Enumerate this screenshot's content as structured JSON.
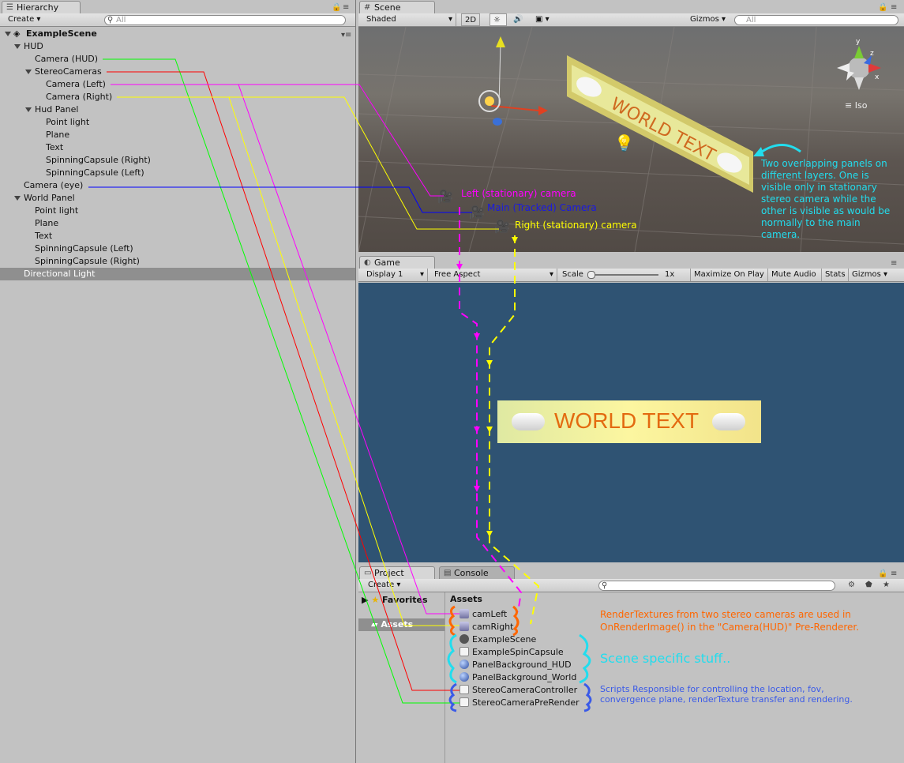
{
  "hierarchy": {
    "tab": "Hierarchy",
    "create": "Create",
    "search_placeholder": "All",
    "scene_name": "ExampleScene",
    "rows": {
      "hud": "HUD",
      "camera_hud": "Camera (HUD)",
      "stereo_cameras": "StereoCameras",
      "camera_left": "Camera (Left)",
      "camera_right": "Camera (Right)",
      "hud_panel": "Hud Panel",
      "point_light_1": "Point light",
      "plane_1": "Plane",
      "text_1": "Text",
      "capsule_right_1": "SpinningCapsule (Right)",
      "capsule_left_1": "SpinningCapsule (Left)",
      "camera_eye": "Camera (eye)",
      "world_panel": "World Panel",
      "point_light_2": "Point light",
      "plane_2": "Plane",
      "text_2": "Text",
      "capsule_left_2": "SpinningCapsule (Left)",
      "capsule_right_2": "SpinningCapsule (Right)",
      "directional_light": "Directional Light"
    }
  },
  "scene": {
    "tab": "Scene",
    "shaded": "Shaded",
    "mode_2d": "2D",
    "gizmos": "Gizmos",
    "search_placeholder": "All",
    "iso": "Iso",
    "world_text": "WORLD TEXT",
    "label_left_cam": "Left (stationary) camera",
    "label_main_cam": "Main (Tracked) Camera",
    "label_right_cam": "Right (stationary) camera",
    "note": "Two overlapping panels on different layers. One is visible only in stationary stereo camera while the other is visible as would be normally to the main camera."
  },
  "game": {
    "tab": "Game",
    "display": "Display 1",
    "aspect": "Free Aspect",
    "scale_label": "Scale",
    "scale_value": "1x",
    "maximize": "Maximize On Play",
    "mute": "Mute Audio",
    "stats": "Stats",
    "gizmos": "Gizmos",
    "world_text": "WORLD TEXT"
  },
  "project": {
    "tab_project": "Project",
    "tab_console": "Console",
    "create": "Create",
    "favorites": "Favorites",
    "assets_side": "Assets",
    "assets_header": "Assets",
    "items": {
      "cam_left": "camLeft",
      "cam_right": "camRight",
      "example_scene": "ExampleScene",
      "spin_capsule": "ExampleSpinCapsule",
      "panel_hud": "PanelBackground_HUD",
      "panel_world": "PanelBackground_World",
      "stereo_controller": "StereoCameraController",
      "stereo_prerender": "StereoCameraPreRender"
    },
    "note_render": "RenderTextures from two stereo cameras are used in OnRenderImage() in the \"Camera(HUD)\" Pre-Renderer.",
    "note_scene": "Scene specific stuff..",
    "note_scripts": "Scripts Responsible for controlling the location, fov, convergence plane, renderTexture transfer and rendering."
  },
  "colors": {
    "magenta": "#ff00ff",
    "yellow": "#ffff00",
    "green": "#00ff00",
    "red": "#ff0000",
    "blue": "#0000ff",
    "cyan": "#22ddee",
    "orange": "#ff6600",
    "game_bg": "#2f5373"
  }
}
